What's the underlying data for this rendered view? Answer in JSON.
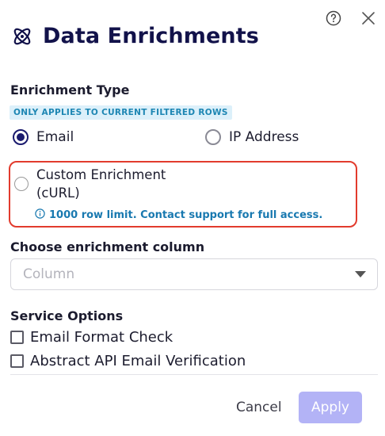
{
  "dialog": {
    "title": "Data Enrichments",
    "icons": {
      "help": "question-circle-icon",
      "close": "close-icon",
      "logo": "atom-icon"
    }
  },
  "enrichment_type": {
    "title": "Enrichment Type",
    "badge": "ONLY APPLIES TO CURRENT FILTERED ROWS",
    "options": [
      {
        "label": "Email",
        "selected": true
      },
      {
        "label": "IP Address",
        "selected": false
      }
    ],
    "custom": {
      "line1": "Custom Enrichment",
      "line2": "(cURL)",
      "selected": false,
      "note": "1000 row limit. Contact support for full access."
    }
  },
  "column": {
    "title": "Choose enrichment column",
    "placeholder": "Column"
  },
  "service_options": {
    "title": "Service Options",
    "items": [
      {
        "label": "Email Format Check",
        "checked": false
      },
      {
        "label": "Abstract API Email Verification",
        "checked": false
      }
    ]
  },
  "footer": {
    "cancel_label": "Cancel",
    "apply_label": "Apply"
  },
  "colors": {
    "title": "#12124a",
    "accent": "#1a1a6e",
    "badge_bg": "#dcf0fa",
    "badge_text": "#1d86b3",
    "highlight_border": "#e23b2d",
    "note_text": "#1979b0",
    "apply_bg": "#b3b3f6"
  }
}
